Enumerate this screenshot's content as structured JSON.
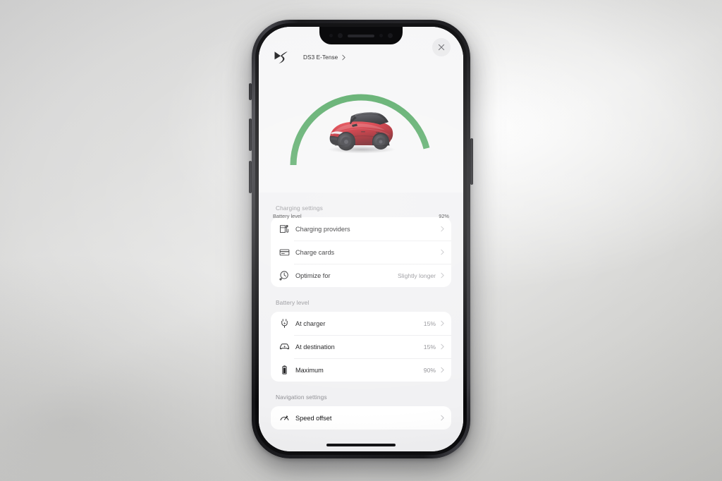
{
  "app": {
    "topbar": {
      "logo_icon": "ds-logo-icon",
      "model_name": "DS3 E-Tense",
      "model_chevron_icon": "chevron-right-icon",
      "close_icon": "close-icon"
    },
    "hero": {
      "gauge": {
        "battery_label": "Battery level",
        "battery_percent_label": "92%",
        "battery_percent_value": 92,
        "arc_color": "#53a863",
        "track_color": "#f6f6f7",
        "vehicle_image": "red-ds3-crossback-car"
      }
    },
    "sections": [
      {
        "title": "Charging settings",
        "rows": [
          {
            "icon": "charging-station-icon",
            "label": "Charging providers",
            "value": "",
            "chevron": "chevron-right-icon"
          },
          {
            "icon": "credit-card-icon",
            "label": "Charge cards",
            "value": "",
            "chevron": "chevron-right-icon"
          },
          {
            "icon": "clock-icon",
            "label": "Optimize for",
            "value": "Slightly longer",
            "chevron": "chevron-right-icon"
          }
        ]
      },
      {
        "title": "Battery level",
        "rows": [
          {
            "icon": "plug-icon",
            "label": "At charger",
            "value": "15%",
            "chevron": "chevron-right-icon"
          },
          {
            "icon": "car-bolt-icon",
            "label": "At destination",
            "value": "15%",
            "chevron": "chevron-right-icon"
          },
          {
            "icon": "battery-icon",
            "label": "Maximum",
            "value": "90%",
            "chevron": "chevron-right-icon"
          }
        ]
      },
      {
        "title": "Navigation settings",
        "rows": [
          {
            "icon": "speedometer-icon",
            "label": "Speed offset",
            "value": "",
            "chevron": "chevron-right-icon"
          }
        ]
      }
    ]
  },
  "device": {
    "notch_speaker": "earpiece-speaker",
    "home_indicator": "home-indicator-bar",
    "buttons": [
      "silent-switch",
      "volume-up",
      "volume-down",
      "power"
    ]
  },
  "colors": {
    "accent_green": "#53a863",
    "page_bg": "#f1f1f3",
    "card_bg": "#ffffff",
    "secondary_text": "#8e8e93",
    "primary_text": "#111113"
  }
}
